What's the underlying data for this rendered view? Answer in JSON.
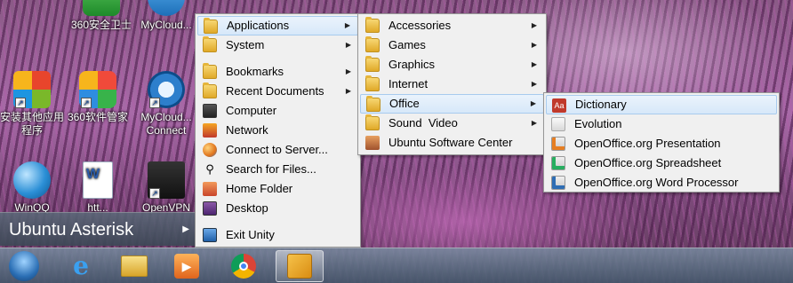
{
  "desktop": {
    "icons": [
      {
        "label": "360安全卫士",
        "icon": "shield-icon"
      },
      {
        "label": "MyCloud...",
        "icon": "cloud-icon"
      },
      {
        "label": "安装其他应用程序",
        "icon": "windows-install-icon"
      },
      {
        "label": "360软件管家",
        "icon": "app-store-icon"
      },
      {
        "label": "MyCloud... Connect",
        "icon": "cloud-connect-icon"
      },
      {
        "label": "WinQQ",
        "icon": "globe-icon"
      },
      {
        "label": "htt...",
        "icon": "word-document-icon"
      },
      {
        "label": "OpenVPN",
        "icon": "network-computers-icon"
      }
    ]
  },
  "start_button": {
    "label": "Ubuntu Asterisk"
  },
  "main_menu": {
    "items": [
      {
        "label": "Applications",
        "icon": "folder-icon",
        "submenu": true
      },
      {
        "label": "System",
        "icon": "folder-icon",
        "submenu": true
      },
      {
        "label": "Bookmarks",
        "icon": "folder-icon",
        "submenu": true
      },
      {
        "label": "Recent Documents",
        "icon": "folder-icon",
        "submenu": true
      },
      {
        "label": "Computer",
        "icon": "computer-icon",
        "submenu": false
      },
      {
        "label": "Network",
        "icon": "network-icon",
        "submenu": false
      },
      {
        "label": "Connect to Server...",
        "icon": "globe-icon",
        "submenu": false
      },
      {
        "label": "Search for Files...",
        "icon": "magnifier-icon",
        "submenu": false
      },
      {
        "label": "Home Folder",
        "icon": "home-folder-icon",
        "submenu": false
      },
      {
        "label": "Desktop",
        "icon": "desktop-icon",
        "submenu": false
      },
      {
        "label": "Exit Unity",
        "icon": "monitor-icon",
        "submenu": false
      }
    ]
  },
  "applications_menu": {
    "items": [
      {
        "label": "Accessories",
        "submenu": true
      },
      {
        "label": "Games",
        "submenu": true
      },
      {
        "label": "Graphics",
        "submenu": true
      },
      {
        "label": "Internet",
        "submenu": true
      },
      {
        "label": "Office",
        "submenu": true
      },
      {
        "label": "Sound  Video",
        "submenu": true
      },
      {
        "label": "Ubuntu Software Center",
        "submenu": false
      }
    ]
  },
  "office_menu": {
    "items": [
      {
        "label": "Dictionary",
        "icon": "dictionary-icon"
      },
      {
        "label": "Evolution",
        "icon": "mail-icon"
      },
      {
        "label": "OpenOffice.org Presentation",
        "icon": "presentation-icon"
      },
      {
        "label": "OpenOffice.org Spreadsheet",
        "icon": "spreadsheet-icon"
      },
      {
        "label": "OpenOffice.org Word Processor",
        "icon": "word-processor-icon"
      }
    ]
  },
  "taskbar": {
    "items": [
      "windows-start-icon",
      "internet-explorer-icon",
      "file-explorer-icon",
      "media-player-icon",
      "chrome-icon",
      "unity-app-icon"
    ]
  }
}
